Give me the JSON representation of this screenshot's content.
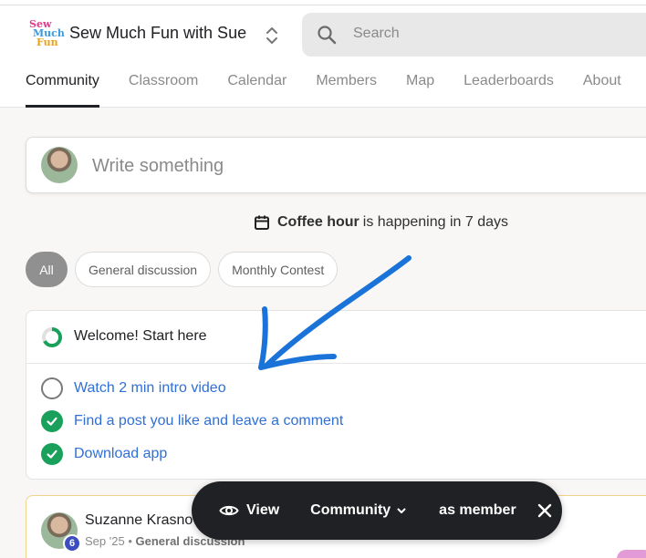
{
  "header": {
    "logo_text": [
      "Sew",
      "Much",
      "Fun"
    ],
    "group_name": "Sew Much Fun with Sue",
    "search_placeholder": "Search"
  },
  "tabs": [
    {
      "label": "Community",
      "active": true
    },
    {
      "label": "Classroom",
      "active": false
    },
    {
      "label": "Calendar",
      "active": false
    },
    {
      "label": "Members",
      "active": false
    },
    {
      "label": "Map",
      "active": false
    },
    {
      "label": "Leaderboards",
      "active": false
    },
    {
      "label": "About",
      "active": false
    }
  ],
  "composer": {
    "placeholder": "Write something"
  },
  "event": {
    "name": "Coffee hour",
    "text": "is happening in 7 days"
  },
  "filters": [
    {
      "label": "All",
      "active": true
    },
    {
      "label": "General discussion",
      "active": false
    },
    {
      "label": "Monthly Contest",
      "active": false
    }
  ],
  "welcome": {
    "title": "Welcome! Start here",
    "progress": 0.67,
    "tasks": [
      {
        "label": "Watch 2 min intro video",
        "done": false
      },
      {
        "label": "Find a post you like and leave a comment",
        "done": true
      },
      {
        "label": "Download app",
        "done": true
      }
    ]
  },
  "post": {
    "author": "Suzanne Krasnow",
    "level": "6",
    "date": "Sep '25",
    "separator": "•",
    "category": "General discussion"
  },
  "viewbar": {
    "view_label": "View",
    "role_select": "Community",
    "as_label": "as member"
  },
  "colors": {
    "accent_blue": "#2f6fd6",
    "check_green": "#19a05a",
    "annotation_blue": "#1a73d9",
    "viewbar_bg": "#202124",
    "level_badge": "#3b4dbf"
  }
}
